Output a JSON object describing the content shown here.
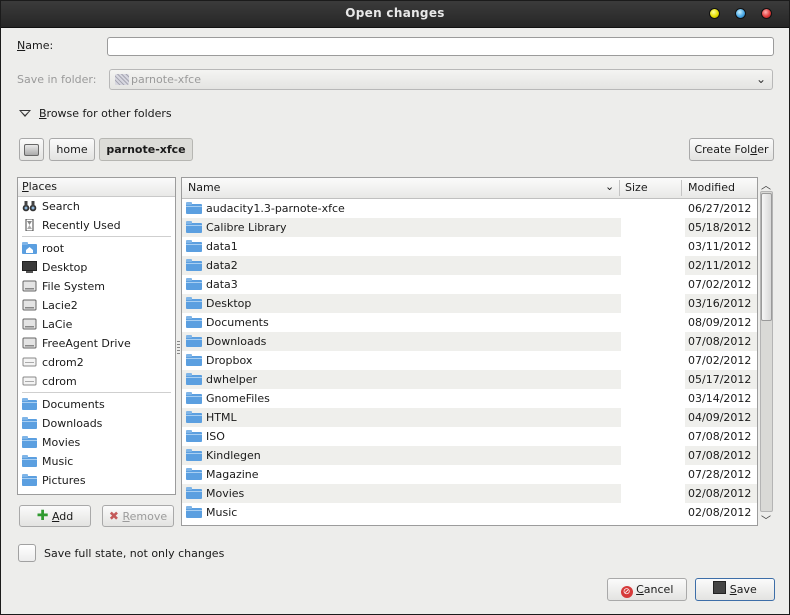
{
  "window": {
    "title": "Open changes"
  },
  "form": {
    "name_label_prefix": "N",
    "name_label_rest": "ame:",
    "name_value": "",
    "folder_label": "Save in folder:",
    "folder_value": "parnote-xfce",
    "browse_label_prefix": "B",
    "browse_label_rest": "rowse for other folders"
  },
  "path": {
    "segments": [
      "home",
      "parnote-xfce"
    ],
    "active_segment": "parnote-xfce",
    "create_folder_label_a": "Create Fol",
    "create_folder_label_u": "d",
    "create_folder_label_b": "er"
  },
  "places": {
    "header_prefix": "P",
    "header_rest": "laces",
    "items": [
      {
        "label": "Search",
        "icon": "binoculars-icon"
      },
      {
        "label": "Recently Used",
        "icon": "clock-icon"
      },
      {
        "label": "root",
        "icon": "home-folder-icon"
      },
      {
        "label": "Desktop",
        "icon": "desktop-icon"
      },
      {
        "label": "File System",
        "icon": "drive-icon"
      },
      {
        "label": "Lacie2",
        "icon": "drive-icon"
      },
      {
        "label": "LaCie",
        "icon": "drive-icon"
      },
      {
        "label": "FreeAgent Drive",
        "icon": "drive-icon"
      },
      {
        "label": "cdrom2",
        "icon": "optical-drive-icon"
      },
      {
        "label": "cdrom",
        "icon": "optical-drive-icon"
      },
      {
        "label": "Documents",
        "icon": "folder-icon"
      },
      {
        "label": "Downloads",
        "icon": "folder-icon"
      },
      {
        "label": "Movies",
        "icon": "folder-icon"
      },
      {
        "label": "Music",
        "icon": "folder-icon"
      },
      {
        "label": "Pictures",
        "icon": "folder-icon"
      }
    ],
    "add_label_prefix": "A",
    "add_label_rest": "dd",
    "remove_label_prefix": "R",
    "remove_label_rest": "emove"
  },
  "files": {
    "columns": {
      "name": "Name",
      "size": "Size",
      "modified": "Modified"
    },
    "rows": [
      {
        "name": "audacity1.3-parnote-xfce",
        "size": "",
        "modified": "06/27/2012"
      },
      {
        "name": "Calibre Library",
        "size": "",
        "modified": "05/18/2012"
      },
      {
        "name": "data1",
        "size": "",
        "modified": "03/11/2012"
      },
      {
        "name": "data2",
        "size": "",
        "modified": "02/11/2012"
      },
      {
        "name": "data3",
        "size": "",
        "modified": "07/02/2012"
      },
      {
        "name": "Desktop",
        "size": "",
        "modified": "03/16/2012"
      },
      {
        "name": "Documents",
        "size": "",
        "modified": "08/09/2012"
      },
      {
        "name": "Downloads",
        "size": "",
        "modified": "07/08/2012"
      },
      {
        "name": "Dropbox",
        "size": "",
        "modified": "07/02/2012"
      },
      {
        "name": "dwhelper",
        "size": "",
        "modified": "05/17/2012"
      },
      {
        "name": "GnomeFiles",
        "size": "",
        "modified": "03/14/2012"
      },
      {
        "name": "HTML",
        "size": "",
        "modified": "04/09/2012"
      },
      {
        "name": "ISO",
        "size": "",
        "modified": "07/08/2012"
      },
      {
        "name": "Kindlegen",
        "size": "",
        "modified": "07/08/2012"
      },
      {
        "name": "Magazine",
        "size": "",
        "modified": "07/28/2012"
      },
      {
        "name": "Movies",
        "size": "",
        "modified": "02/08/2012"
      },
      {
        "name": "Music",
        "size": "",
        "modified": "02/08/2012"
      }
    ]
  },
  "options": {
    "save_full_state_label": "Save full state, not only changes",
    "save_full_state_checked": false
  },
  "actions": {
    "cancel_prefix": "C",
    "cancel_rest": "ancel",
    "save_prefix": "S",
    "save_rest": "ave"
  },
  "colors": {
    "folder_blue": "#5b9fe0",
    "titlebar": "#2e2e2e",
    "window_bg": "#ededeb"
  }
}
